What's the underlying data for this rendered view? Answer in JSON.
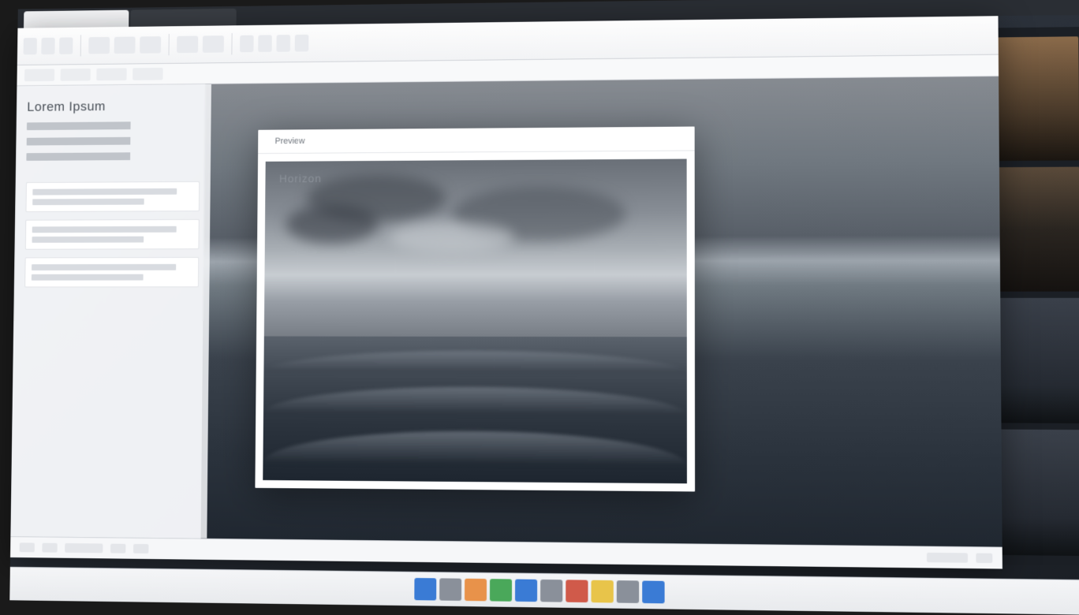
{
  "sidebar": {
    "title": "Lorem Ipsum"
  },
  "preview": {
    "tab_label": "Preview",
    "caption": "Horizon"
  }
}
